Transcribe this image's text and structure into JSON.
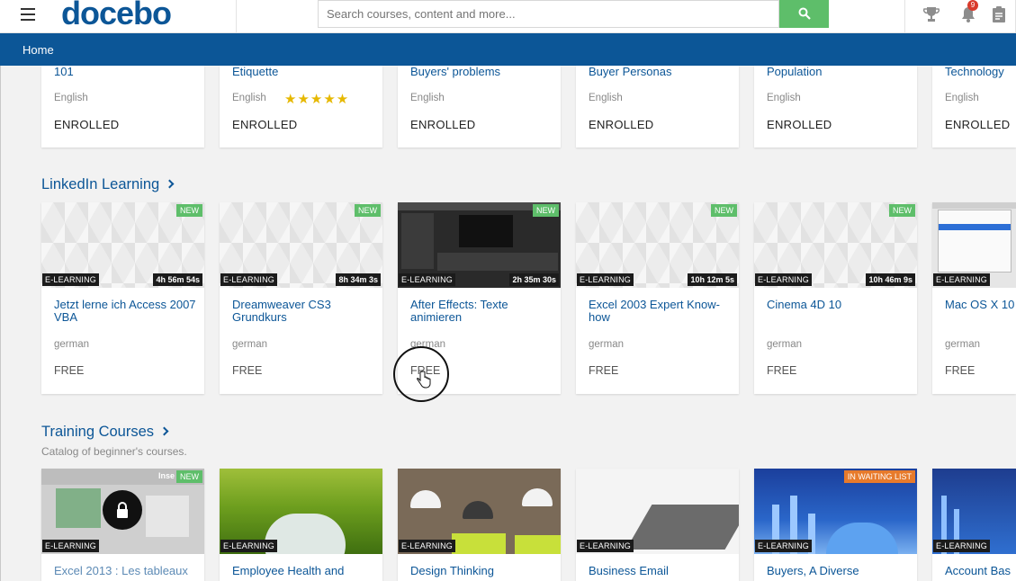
{
  "header": {
    "logo": "docebo",
    "logo_mark": "®",
    "search_placeholder": "Search courses, content and more...",
    "notifications_count": "9"
  },
  "nav": {
    "home": "Home"
  },
  "enrolled_row": [
    {
      "title": "101",
      "lang": "English",
      "status": "ENROLLED"
    },
    {
      "title": "Etiquette",
      "lang": "English",
      "status": "ENROLLED",
      "rating": "★★★★★"
    },
    {
      "title": "Buyers' problems",
      "lang": "English",
      "status": "ENROLLED"
    },
    {
      "title": "Buyer Personas",
      "lang": "English",
      "status": "ENROLLED"
    },
    {
      "title": "Population",
      "lang": "English",
      "status": "ENROLLED"
    },
    {
      "title": "Technology",
      "lang": "English",
      "status": "ENROLLED"
    }
  ],
  "linkedin": {
    "title": "LinkedIn Learning",
    "cards": [
      {
        "title": "Jetzt lerne ich Access 2007 VBA",
        "type": "E-LEARNING",
        "duration": "4h 56m 54s",
        "badge": "NEW",
        "lang": "german",
        "price": "FREE"
      },
      {
        "title": "Dreamweaver CS3 Grundkurs",
        "type": "E-LEARNING",
        "duration": "8h 34m 3s",
        "badge": "NEW",
        "lang": "german",
        "price": "FREE"
      },
      {
        "title": "After Effects: Texte animieren",
        "type": "E-LEARNING",
        "duration": "2h 35m 30s",
        "badge": "NEW",
        "lang": "german",
        "price": "FREE"
      },
      {
        "title": "Excel 2003 Expert Know-how",
        "type": "E-LEARNING",
        "duration": "10h 12m 5s",
        "badge": "NEW",
        "lang": "german",
        "price": "FREE"
      },
      {
        "title": "Cinema 4D 10",
        "type": "E-LEARNING",
        "duration": "10h 46m 9s",
        "badge": "NEW",
        "lang": "german",
        "price": "FREE"
      },
      {
        "title": "Mac OS X 10",
        "type": "E-LEARNING",
        "duration": "",
        "badge": "",
        "lang": "german",
        "price": "FREE"
      }
    ]
  },
  "training": {
    "title": "Training Courses",
    "subtitle": "Catalog of beginner's courses.",
    "cards": [
      {
        "title": "Excel 2013 : Les tableaux",
        "type": "E-LEARNING",
        "badge": "NEW",
        "overlay_text": "Inse"
      },
      {
        "title": "Employee Health and",
        "type": "E-LEARNING",
        "badge": ""
      },
      {
        "title": "Design Thinking",
        "type": "E-LEARNING",
        "badge": ""
      },
      {
        "title": "Business Email",
        "type": "E-LEARNING",
        "badge": ""
      },
      {
        "title": "Buyers, A Diverse",
        "type": "E-LEARNING",
        "badge": "IN WAITING LIST"
      },
      {
        "title": "Account Bas",
        "type": "E-LEARNING",
        "badge": ""
      }
    ]
  },
  "colors": {
    "brand": "#0c5697",
    "search_button": "#5ebe6a",
    "new_badge": "#5ebe6a",
    "waiting_badge": "#e77a2b",
    "notification_badge": "#d93a2b"
  }
}
